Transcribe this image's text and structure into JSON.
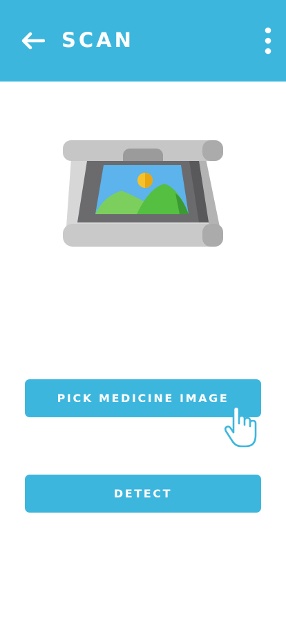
{
  "colors": {
    "accent": "#3db6de",
    "on_accent": "#ffffff"
  },
  "header": {
    "title": "SCAN",
    "back_icon": "arrow-left-icon",
    "menu_icon": "more-vertical-icon"
  },
  "illustration": {
    "icon": "scanner-illustration"
  },
  "actions": {
    "pick_label": "PICK MEDICINE IMAGE",
    "detect_label": "DETECT"
  },
  "cursor": {
    "icon": "hand-pointer-icon"
  }
}
